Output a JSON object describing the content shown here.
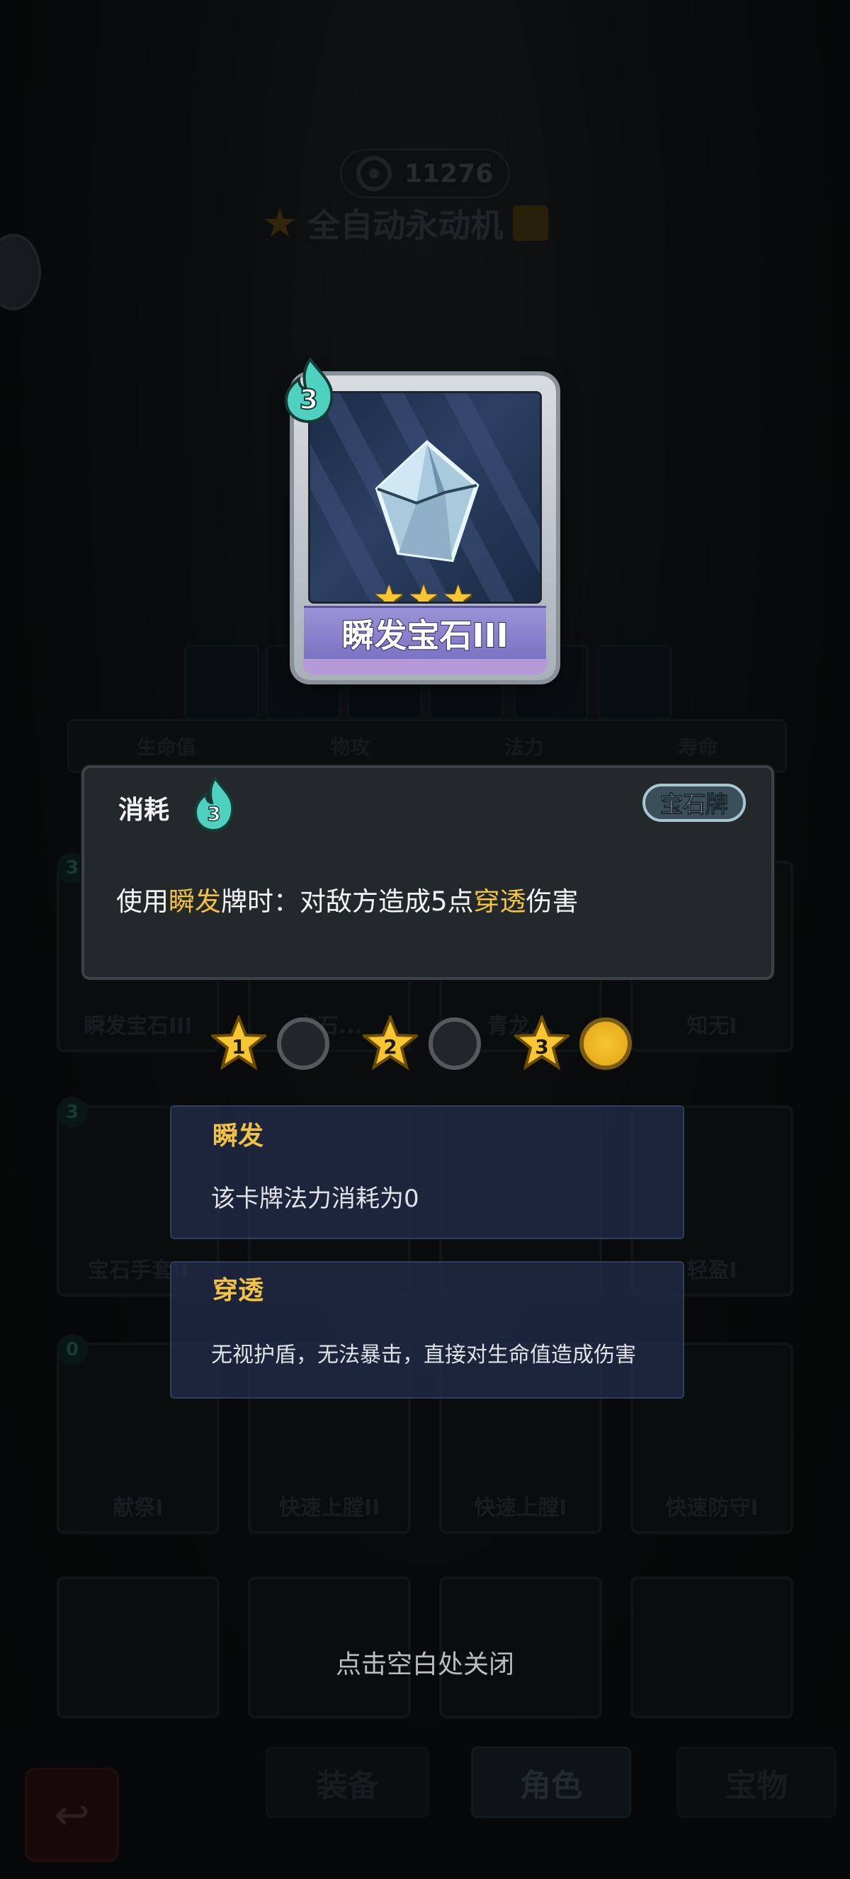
{
  "background": {
    "score": "11276",
    "build_name": "全自动永动机",
    "stats": [
      "生命值",
      "物攻",
      "法力",
      "寿命"
    ],
    "grid_cards": [
      {
        "name": "瞬发宝石III",
        "cost": "3"
      },
      {
        "name": "宝石...",
        "cost": ""
      },
      {
        "name": "青龙...",
        "cost": ""
      },
      {
        "name": "知无I",
        "cost": ""
      },
      {
        "name": "宝石手套II",
        "cost": "3"
      },
      {
        "name": "",
        "cost": ""
      },
      {
        "name": "",
        "cost": ""
      },
      {
        "name": "轻盈I",
        "cost": ""
      },
      {
        "name": "献祭I",
        "cost": "0"
      },
      {
        "name": "快速上膛II",
        "cost": ""
      },
      {
        "name": "快速上膛I",
        "cost": ""
      },
      {
        "name": "快速防守I",
        "cost": ""
      }
    ],
    "tabs": [
      "装备",
      "角色",
      "宝物"
    ]
  },
  "card": {
    "cost": "3",
    "name": "瞬发宝石III",
    "stars": "★★★"
  },
  "detail": {
    "consume_label": "消耗",
    "consume_value": "3",
    "type_tag": "宝石牌",
    "desc_prefix": "使用",
    "desc_kw1": "瞬发",
    "desc_mid": "牌时：对敌方造成5点",
    "desc_kw2": "穿透",
    "desc_suffix": "伤害"
  },
  "levels": {
    "labels": [
      "1",
      "2",
      "3"
    ],
    "active_level": 3
  },
  "keywords": [
    {
      "title": "瞬发",
      "text": "该卡牌法力消耗为0"
    },
    {
      "title": "穿透",
      "text": "无视护盾，无法暴击，直接对生命值造成伤害"
    }
  ],
  "close_hint": "点击空白处关闭",
  "colors": {
    "keyword": "#f1c243",
    "card_band": "#8a80cc",
    "flame": "#4fd1c0"
  }
}
